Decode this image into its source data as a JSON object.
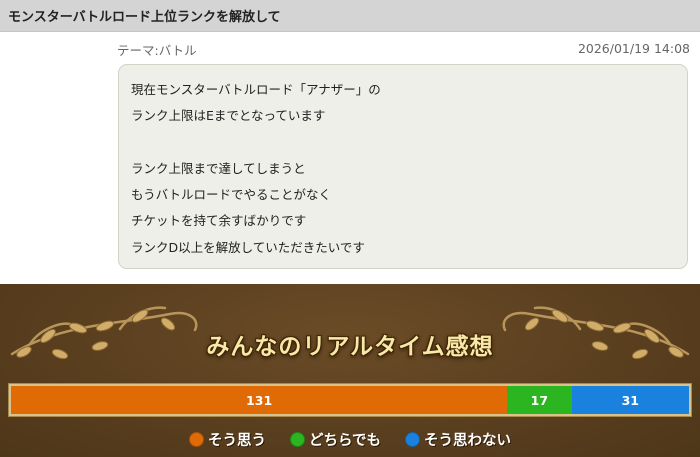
{
  "post": {
    "title": "モンスターバトルロード上位ランクを解放して",
    "theme": "テーマ:バトル",
    "date": "2026/01/19 14:08",
    "body_lines": [
      "現在モンスターバトルロード「アナザー」の",
      "ランク上限はEまでとなっています",
      "",
      "ランク上限まで達してしまうと",
      "もうバトルロードでやることがなく",
      "チケットを持て余すばかりです",
      "ランクD以上を解放していただきたいです"
    ]
  },
  "poll": {
    "title": "みんなのリアルタイム感想",
    "results": [
      {
        "label": "そう思う",
        "count": 131,
        "count_text": "131",
        "color": "#e06a06"
      },
      {
        "label": "どちらでも",
        "count": 17,
        "count_text": "17",
        "color": "#2bb521"
      },
      {
        "label": "そう思わない",
        "count": 31,
        "count_text": "31",
        "color": "#1a82de"
      }
    ]
  }
}
